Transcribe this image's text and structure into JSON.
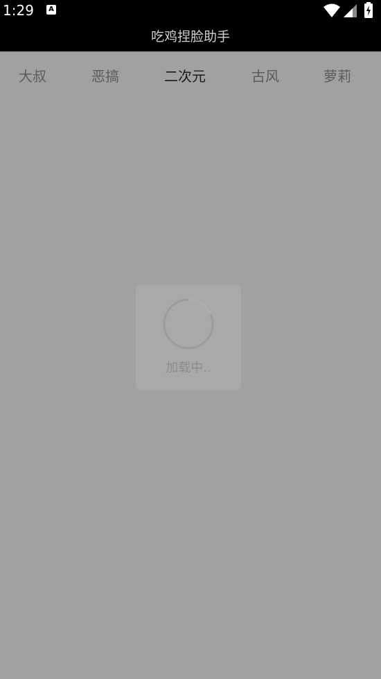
{
  "status_bar": {
    "time": "1:29",
    "notification_glyph": "A",
    "icons": [
      "notification-icon",
      "wifi-icon",
      "signal-icon",
      "battery-icon"
    ]
  },
  "app": {
    "title": "吃鸡捏脸助手"
  },
  "tabs": [
    {
      "label": "大叔",
      "active": false
    },
    {
      "label": "恶搞",
      "active": false
    },
    {
      "label": "二次元",
      "active": true
    },
    {
      "label": "古风",
      "active": false
    },
    {
      "label": "萝莉",
      "active": false
    }
  ],
  "loading": {
    "text": "加载中.."
  },
  "colors": {
    "status_bar": "#000000",
    "title_bar": "#000000",
    "overlay": "#a1a1a1",
    "active_tab": "#1a1a1a",
    "inactive_tab": "#5b5b5b"
  }
}
